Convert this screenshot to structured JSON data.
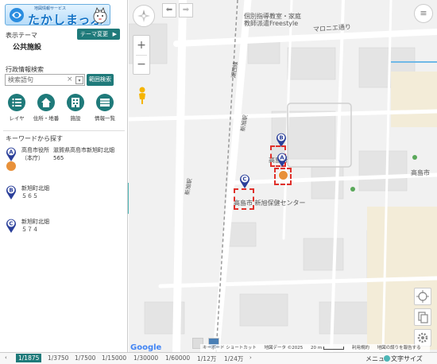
{
  "logo": {
    "subtitle": "地図情報サービス",
    "title": "たかしまっぷ"
  },
  "theme": {
    "label": "表示テーマ",
    "name": "公共施設",
    "change_button": "テーマ変更"
  },
  "search": {
    "label": "行政情報検索",
    "placeholder": "検索語句",
    "clear_icon": "close-icon",
    "area_button": "範囲検索"
  },
  "nav": [
    {
      "label": "レイヤ",
      "icon": "list-icon"
    },
    {
      "label": "住所・地番",
      "icon": "home-icon"
    },
    {
      "label": "施設",
      "icon": "building-icon"
    },
    {
      "label": "情報一覧",
      "icon": "table-icon"
    }
  ],
  "keyword": {
    "label": "キーワードから探す"
  },
  "results": [
    {
      "marker": "A",
      "name": "高島市役所（本庁）",
      "address": "滋賀県高島市新旭町北畑565"
    },
    {
      "marker": "B",
      "name": "新旭町北畑５６５",
      "address": ""
    },
    {
      "marker": "C",
      "name": "新旭町北畑５７４",
      "address": ""
    }
  ],
  "map": {
    "labels": {
      "classroom": "個別指導教室・家庭",
      "freestyle": "教師派遣Freestyle",
      "marone": "マロニエ通り",
      "jr": "湖西線",
      "shinasahi_station": "新旭駅",
      "city_hall_short": "高島",
      "city_hall_suffix": "所",
      "health_center": "高島市 新旭保健センター",
      "takashima": "高島市"
    },
    "attribution": {
      "keyboard": "キーボード ショートカット",
      "map_data": "地図データ ©2025",
      "scale": "20 m",
      "terms": "利用規約",
      "report": "地図の誤りを報告する"
    },
    "google": "Google",
    "markers": [
      "A",
      "B",
      "C"
    ]
  },
  "scales": [
    "1/1875",
    "1/3750",
    "1/7500",
    "1/15000",
    "1/30000",
    "1/60000",
    "1/12万",
    "1/24万"
  ],
  "active_scale": "1/1875",
  "footer": {
    "menu": "メニュー",
    "font_size": "文字サイズ"
  },
  "colors": {
    "accent": "#1f7a7a",
    "marker": "#2a3f9a",
    "selection": "#e0302a",
    "handle": "#4db6b6"
  }
}
